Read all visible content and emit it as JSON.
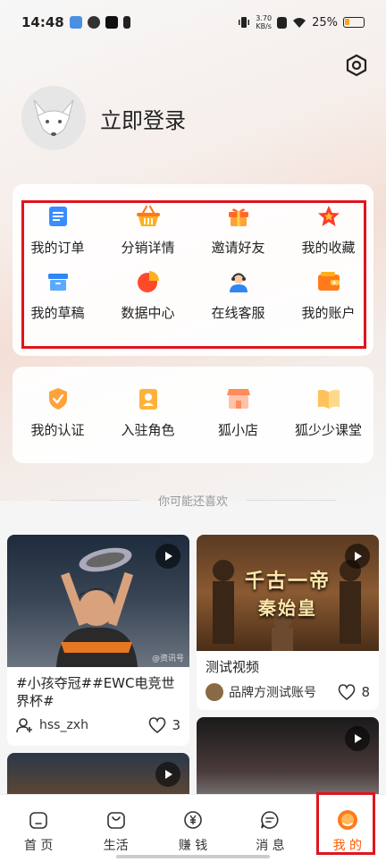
{
  "status_bar": {
    "time": "14:48",
    "net_speed_value": "3.70",
    "net_speed_unit": "KB/s",
    "battery": "25%"
  },
  "profile": {
    "login_label": "立即登录"
  },
  "main_menu": [
    {
      "label": "我的订单",
      "icon": "order-icon"
    },
    {
      "label": "分销详情",
      "icon": "basket-icon"
    },
    {
      "label": "邀请好友",
      "icon": "gift-icon"
    },
    {
      "label": "我的收藏",
      "icon": "star-icon"
    },
    {
      "label": "我的草稿",
      "icon": "draft-box-icon"
    },
    {
      "label": "数据中心",
      "icon": "pie-chart-icon"
    },
    {
      "label": "在线客服",
      "icon": "customer-service-icon"
    },
    {
      "label": "我的账户",
      "icon": "wallet-icon"
    }
  ],
  "secondary_menu": [
    {
      "label": "我的认证",
      "icon": "certification-icon"
    },
    {
      "label": "入驻角色",
      "icon": "role-badge-icon"
    },
    {
      "label": "狐小店",
      "icon": "shop-icon"
    },
    {
      "label": "狐少少课堂",
      "icon": "book-icon"
    }
  ],
  "recommend": {
    "title": "你可能还喜欢",
    "items": [
      {
        "title": "#小孩夺冠##EWC电竞世界杯#",
        "author": "hss_zxh",
        "likes": "3",
        "watermark": "@资讯号"
      },
      {
        "title": "测试视频",
        "author": "品牌方测试账号",
        "likes": "8",
        "overlay_text_1": "千古一帝",
        "overlay_text_2": "秦始皇"
      }
    ]
  },
  "tab_bar": [
    {
      "label": "首 页",
      "icon": "home-icon"
    },
    {
      "label": "生活",
      "icon": "bag-icon"
    },
    {
      "label": "赚 钱",
      "icon": "yuan-coin-icon"
    },
    {
      "label": "消 息",
      "icon": "message-icon"
    },
    {
      "label": "我 的",
      "icon": "profile-icon",
      "active": true
    }
  ],
  "colors": {
    "accent": "#ff5a00",
    "highlight": "#e0141e"
  }
}
